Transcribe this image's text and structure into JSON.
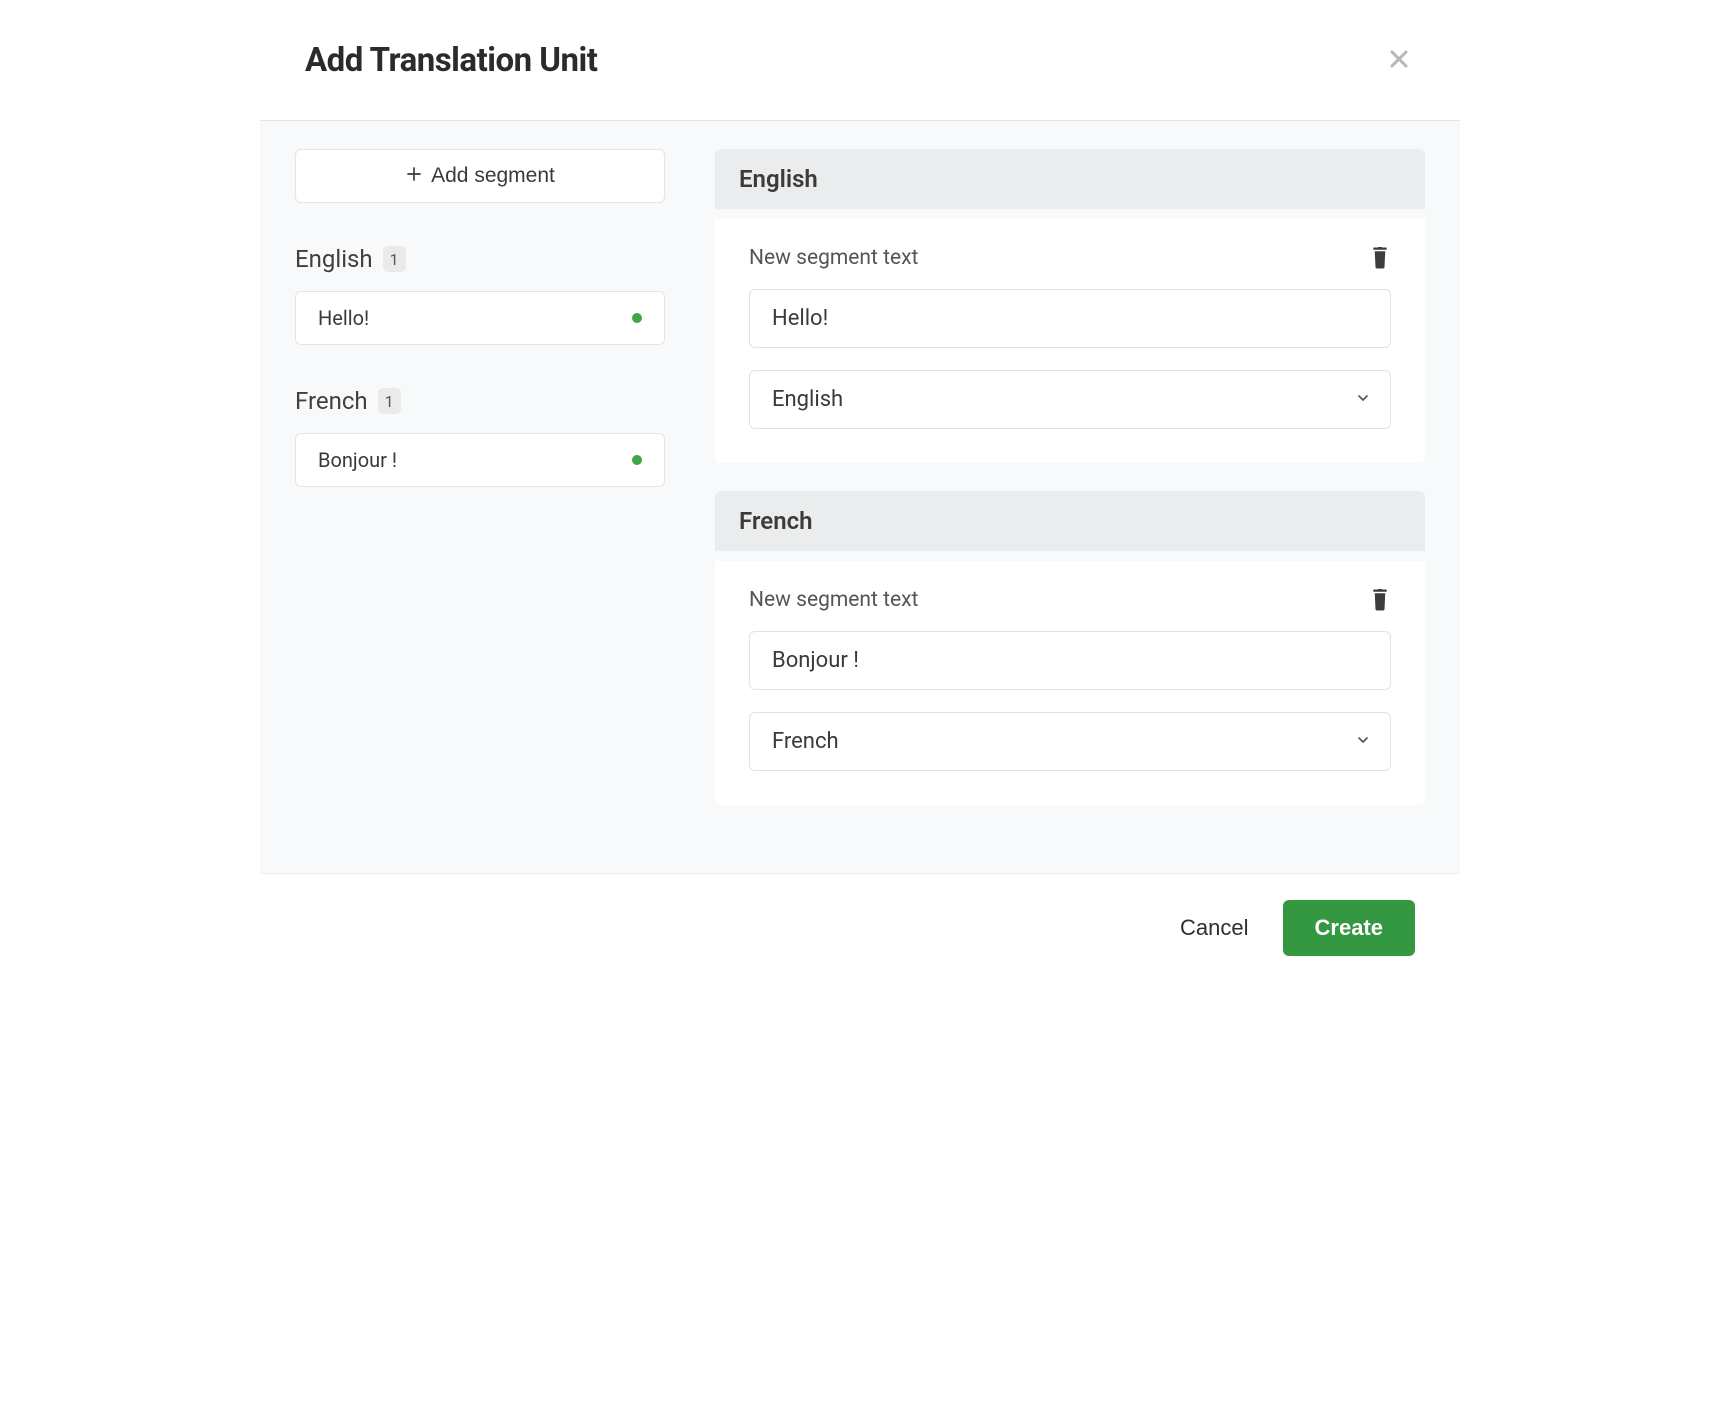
{
  "header": {
    "title": "Add Translation Unit"
  },
  "sidebar": {
    "add_segment_label": "Add segment",
    "groups": [
      {
        "language": "English",
        "count": "1",
        "items": [
          {
            "text": "Hello!"
          }
        ]
      },
      {
        "language": "French",
        "count": "1",
        "items": [
          {
            "text": "Bonjour !"
          }
        ]
      }
    ]
  },
  "panels": [
    {
      "language_header": "English",
      "segment_label": "New segment text",
      "text_value": "Hello!",
      "language_selected": "English"
    },
    {
      "language_header": "French",
      "segment_label": "New segment text",
      "text_value": "Bonjour !",
      "language_selected": "French"
    }
  ],
  "footer": {
    "cancel": "Cancel",
    "create": "Create"
  },
  "colors": {
    "status_dot": "#3fa648",
    "create_button": "#349843"
  }
}
